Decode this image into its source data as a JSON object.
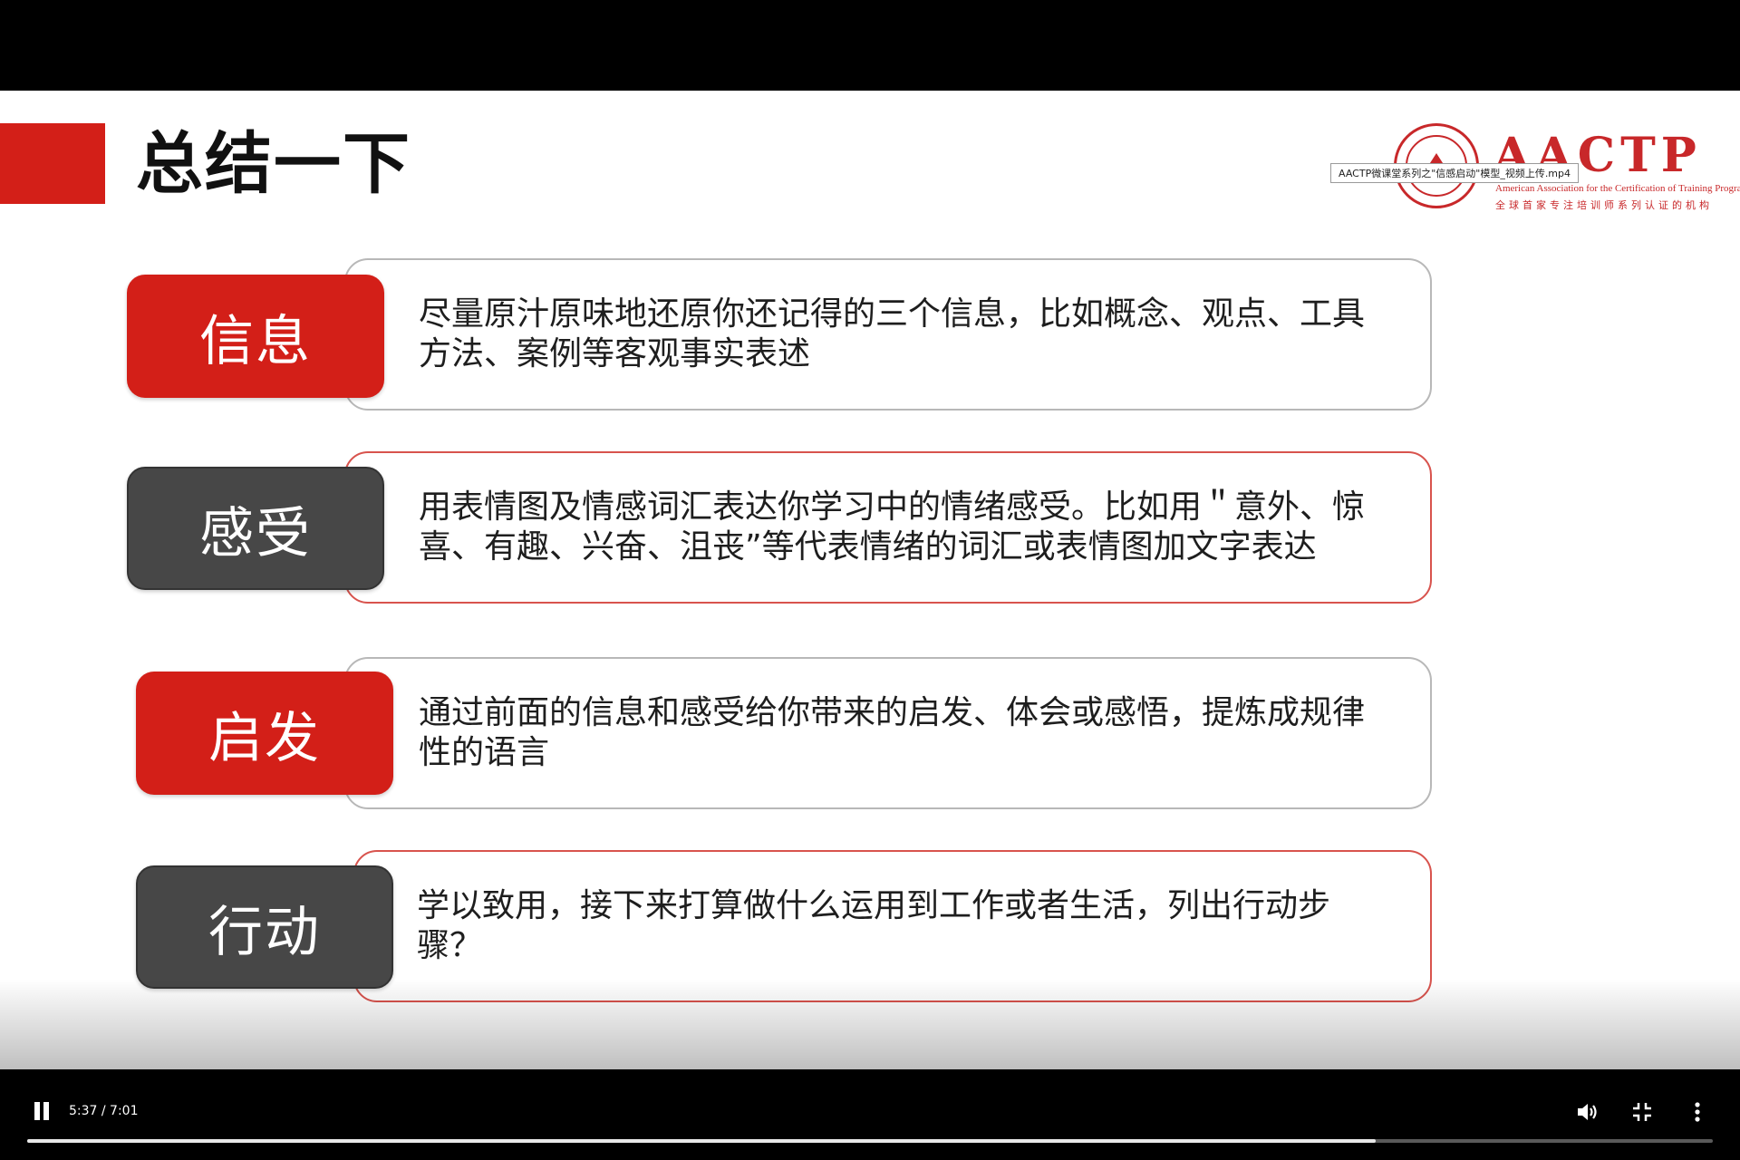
{
  "slide": {
    "title": "总结一下",
    "logo": {
      "wordmark": "AACTP",
      "subtitle_en": "American Association for the Certification of Training Program",
      "subtitle_cn": "全球首家专注培训师系列认证的机构"
    },
    "filename_tooltip": "AACTP微课堂系列之\"信感启动\"模型_视频上传.mp4",
    "rows": [
      {
        "label": "信息",
        "label_color": "#d31f18",
        "text": "尽量原汁原味地还原你还记得的三个信息，比如概念、观点、工具方法、案例等客观事实表述"
      },
      {
        "label": "感受",
        "label_color": "#474747",
        "text": "用表情图及情感词汇表达你学习中的情绪感受。比如用＂意外、惊喜、有趣、兴奋、沮丧”等代表情绪的词汇或表情图加文字表达"
      },
      {
        "label": "启发",
        "label_color": "#d31f18",
        "text": "通过前面的信息和感受给你带来的启发、体会或感悟，提炼成规律性的语言"
      },
      {
        "label": "行动",
        "label_color": "#474747",
        "text": "学以致用，接下来打算做什么运用到工作或者生活，列出行动步骤？"
      }
    ]
  },
  "player": {
    "time": "5:37 / 7:01",
    "progress_fraction": 0.8,
    "icons": [
      "pause-icon",
      "volume-icon",
      "exit-fullscreen-icon",
      "more-options-icon"
    ]
  }
}
